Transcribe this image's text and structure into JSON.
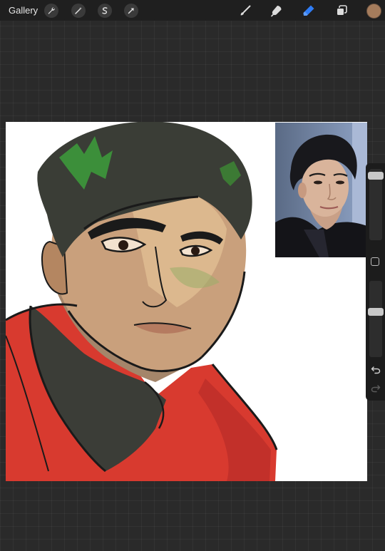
{
  "toolbar": {
    "gallery_label": "Gallery",
    "left_tools": [
      "wrench-icon",
      "magic-wand-icon",
      "selection-icon",
      "transform-icon"
    ],
    "right_tools": [
      "brush-icon",
      "smudge-icon",
      "eraser-icon",
      "layers-icon"
    ],
    "active_tool": "eraser-icon",
    "current_color": "#a57c5c"
  },
  "sidebar": {
    "brush_size": 0.95,
    "opacity": 0.6,
    "controls": [
      "brush-size-slider",
      "modify-button",
      "opacity-slider",
      "undo-icon",
      "redo-icon"
    ]
  },
  "colors": {
    "background": "#2a2a2a",
    "toolbar": "#1f1f1f",
    "accent_eraser": "#2f7df6",
    "jacket_red": "#d83a2f",
    "hair": "#3a3d36",
    "hair_highlight": "#3c8f3a",
    "skin": "#d2a479"
  }
}
